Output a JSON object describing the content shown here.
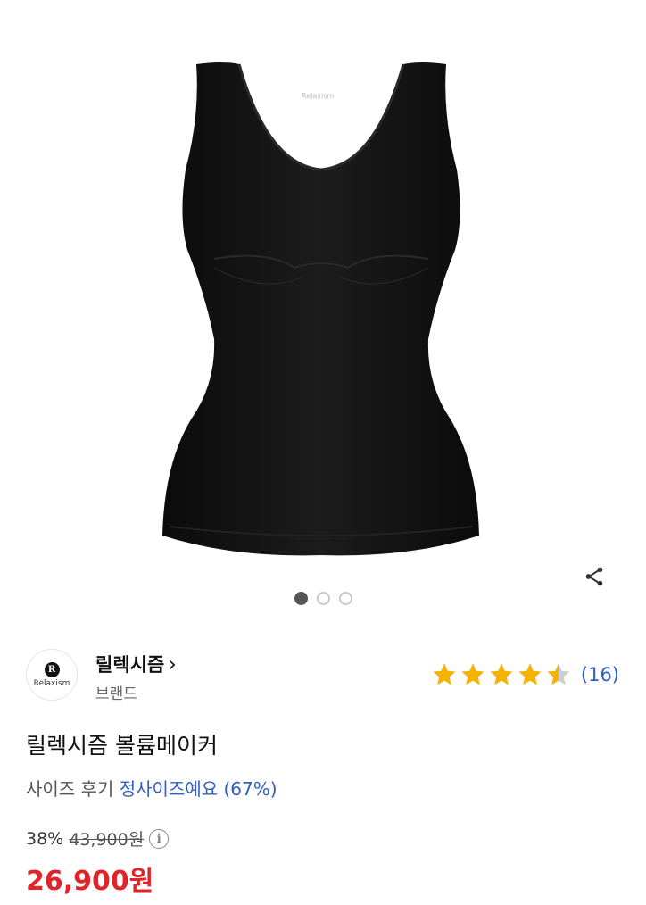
{
  "product_image": {
    "alt": "black shaping tank top",
    "label_text": "Relaxism",
    "slide_count": 3,
    "active_slide": 1
  },
  "share": {
    "icon": "share-icon"
  },
  "brand": {
    "logo_text": "Relaxism",
    "logo_mark": "R",
    "name": "릴렉시즘",
    "chevron": "›",
    "subtitle": "브랜드"
  },
  "rating": {
    "stars": 4.5,
    "max": 5,
    "count_text": "(16)",
    "star_color": "#f5b301",
    "empty_color": "#cfcfcf"
  },
  "product": {
    "title": "릴렉시즘 볼륨메이커"
  },
  "size_review": {
    "label": "사이즈 후기",
    "value": "정사이즈예요 (67%)"
  },
  "price": {
    "discount": "38%",
    "original": "43,900원",
    "current": "26,900원",
    "info_icon": "i"
  },
  "colors": {
    "accent_blue": "#2f5fc4",
    "price_red": "#e0252a"
  }
}
